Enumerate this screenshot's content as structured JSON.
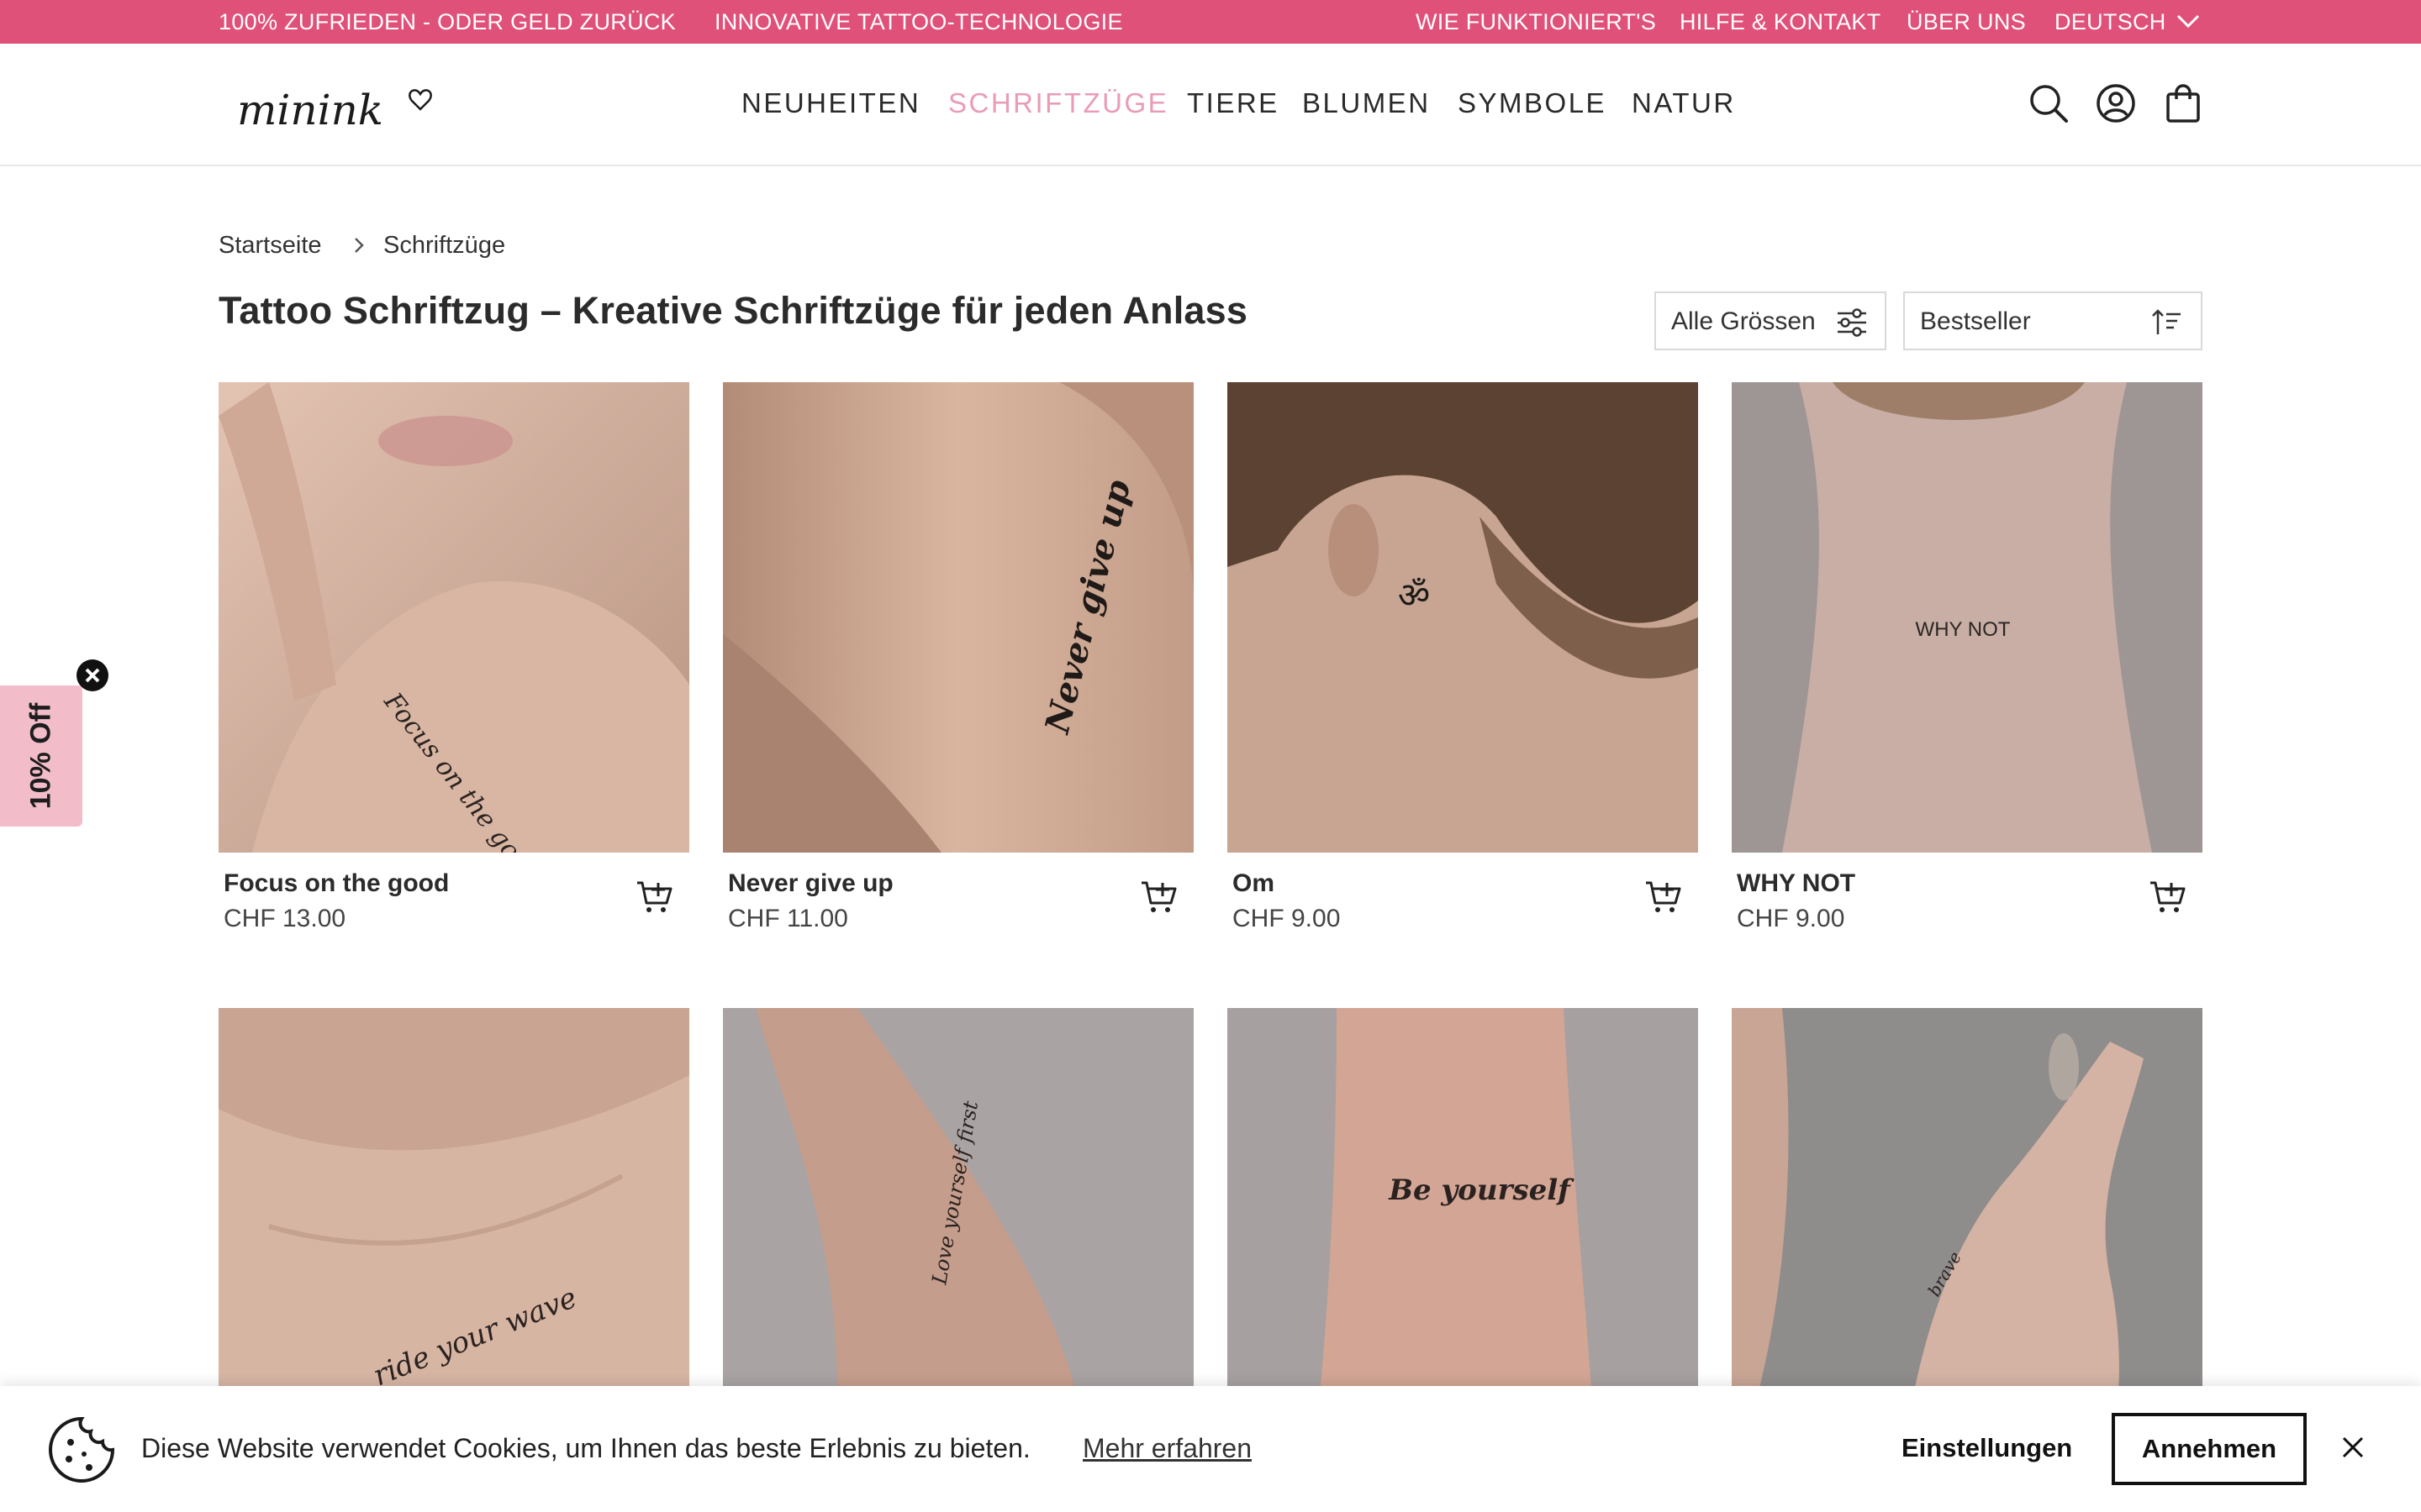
{
  "announcement": {
    "left": [
      "100% ZUFRIEDEN - ODER GELD ZURÜCK",
      "INNOVATIVE TATTOO-TECHNOLOGIE"
    ],
    "right": [
      "WIE FUNKTIONIERT'S",
      "HILFE & KONTAKT",
      "ÜBER UNS",
      "DEUTSCH"
    ]
  },
  "header": {
    "logo": "minink",
    "nav": [
      "NEUHEITEN",
      "SCHRIFTZÜGE",
      "TIERE",
      "BLUMEN",
      "SYMBOLE",
      "NATUR"
    ],
    "active_nav": "SCHRIFTZÜGE",
    "icons": [
      "search-icon",
      "account-icon",
      "shopping-bag-icon"
    ]
  },
  "breadcrumb": [
    "Startseite",
    "Schriftzüge"
  ],
  "page_title": "Tattoo Schriftzug – Kreative Schriftzüge für jeden Anlass",
  "filters": {
    "size": "Alle Grössen",
    "sort": "Bestseller"
  },
  "products": [
    {
      "name": "Focus on the good",
      "price": "CHF 13.00",
      "tattoo_text": "Focus on the good"
    },
    {
      "name": "Never give up",
      "price": "CHF 11.00",
      "tattoo_text": "Never give up"
    },
    {
      "name": "Om",
      "price": "CHF 9.00",
      "tattoo_text": "ॐ"
    },
    {
      "name": "WHY NOT",
      "price": "CHF 9.00",
      "tattoo_text": "WHY NOT"
    },
    {
      "name": "",
      "price": "",
      "tattoo_text": "ride your wave"
    },
    {
      "name": "",
      "price": "",
      "tattoo_text": "Love yourself first"
    },
    {
      "name": "",
      "price": "",
      "tattoo_text": "Be yourself"
    },
    {
      "name": "",
      "price": "",
      "tattoo_text": "brave"
    }
  ],
  "discount_tab": {
    "label": "10% Off"
  },
  "cookie_bar": {
    "message": "Diese Website verwendet Cookies, um Ihnen das beste Erlebnis zu bieten.",
    "learn_more": "Mehr erfahren",
    "settings": "Einstellungen",
    "accept": "Annehmen"
  },
  "colors": {
    "brand_pink": "#e0517a",
    "nav_active": "#e99bb7",
    "discount_bg": "#f2bcc9"
  }
}
